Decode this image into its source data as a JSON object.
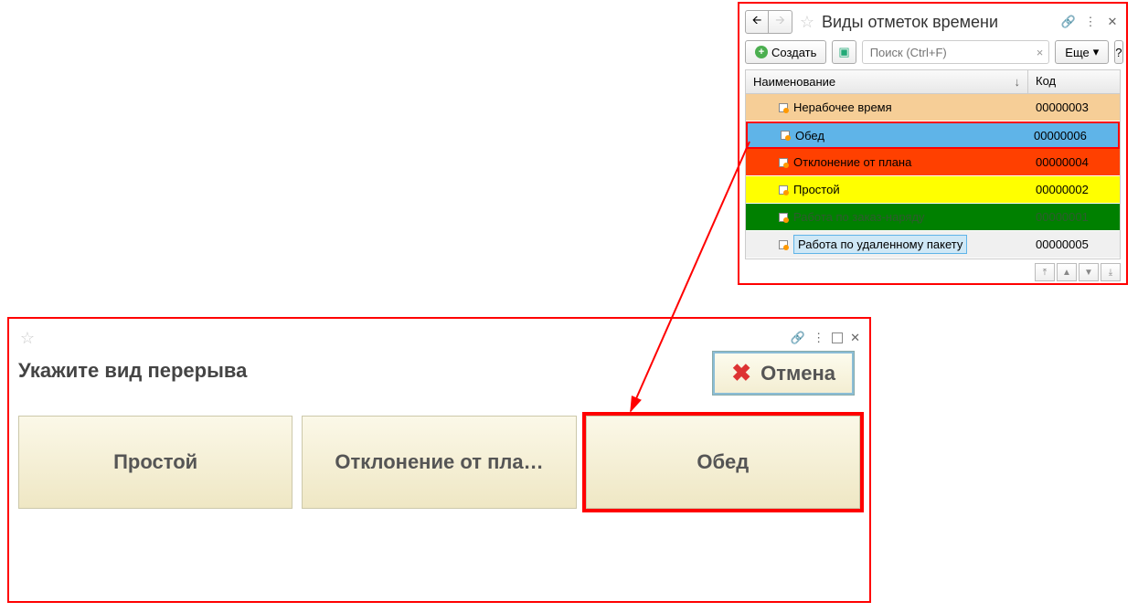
{
  "catalog": {
    "title": "Виды отметок времени",
    "create_label": "Создать",
    "search_placeholder": "Поиск (Ctrl+F)",
    "more_label": "Еще",
    "columns": {
      "name": "Наименование",
      "code": "Код"
    },
    "rows": [
      {
        "name": "Нерабочее время",
        "code": "00000003"
      },
      {
        "name": "Обед",
        "code": "00000006"
      },
      {
        "name": "Отклонение от плана",
        "code": "00000004"
      },
      {
        "name": "Простой",
        "code": "00000002"
      },
      {
        "name": "Работа по заказ-наряду",
        "code": "00000001"
      },
      {
        "name": "Работа по удаленному пакету",
        "code": "00000005"
      }
    ]
  },
  "dialog": {
    "title": "Укажите вид перерыва",
    "cancel_label": "Отмена",
    "buttons": [
      {
        "label": "Простой"
      },
      {
        "label": "Отклонение от пла…"
      },
      {
        "label": "Обед"
      }
    ]
  }
}
